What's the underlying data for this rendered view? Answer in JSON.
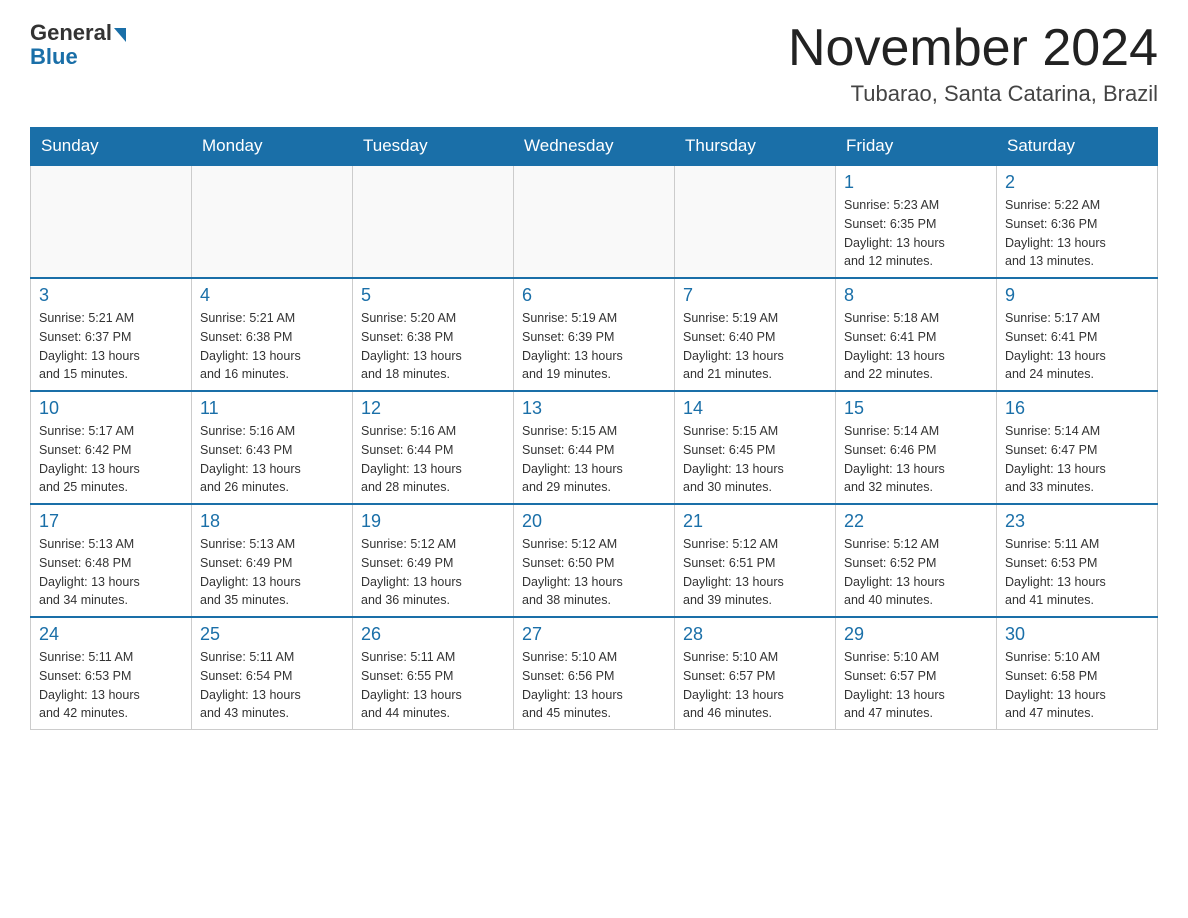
{
  "header": {
    "logo_general": "General",
    "logo_blue": "Blue",
    "month_title": "November 2024",
    "location": "Tubarao, Santa Catarina, Brazil"
  },
  "days_of_week": [
    "Sunday",
    "Monday",
    "Tuesday",
    "Wednesday",
    "Thursday",
    "Friday",
    "Saturday"
  ],
  "weeks": [
    [
      {
        "day": "",
        "info": ""
      },
      {
        "day": "",
        "info": ""
      },
      {
        "day": "",
        "info": ""
      },
      {
        "day": "",
        "info": ""
      },
      {
        "day": "",
        "info": ""
      },
      {
        "day": "1",
        "info": "Sunrise: 5:23 AM\nSunset: 6:35 PM\nDaylight: 13 hours\nand 12 minutes."
      },
      {
        "day": "2",
        "info": "Sunrise: 5:22 AM\nSunset: 6:36 PM\nDaylight: 13 hours\nand 13 minutes."
      }
    ],
    [
      {
        "day": "3",
        "info": "Sunrise: 5:21 AM\nSunset: 6:37 PM\nDaylight: 13 hours\nand 15 minutes."
      },
      {
        "day": "4",
        "info": "Sunrise: 5:21 AM\nSunset: 6:38 PM\nDaylight: 13 hours\nand 16 minutes."
      },
      {
        "day": "5",
        "info": "Sunrise: 5:20 AM\nSunset: 6:38 PM\nDaylight: 13 hours\nand 18 minutes."
      },
      {
        "day": "6",
        "info": "Sunrise: 5:19 AM\nSunset: 6:39 PM\nDaylight: 13 hours\nand 19 minutes."
      },
      {
        "day": "7",
        "info": "Sunrise: 5:19 AM\nSunset: 6:40 PM\nDaylight: 13 hours\nand 21 minutes."
      },
      {
        "day": "8",
        "info": "Sunrise: 5:18 AM\nSunset: 6:41 PM\nDaylight: 13 hours\nand 22 minutes."
      },
      {
        "day": "9",
        "info": "Sunrise: 5:17 AM\nSunset: 6:41 PM\nDaylight: 13 hours\nand 24 minutes."
      }
    ],
    [
      {
        "day": "10",
        "info": "Sunrise: 5:17 AM\nSunset: 6:42 PM\nDaylight: 13 hours\nand 25 minutes."
      },
      {
        "day": "11",
        "info": "Sunrise: 5:16 AM\nSunset: 6:43 PM\nDaylight: 13 hours\nand 26 minutes."
      },
      {
        "day": "12",
        "info": "Sunrise: 5:16 AM\nSunset: 6:44 PM\nDaylight: 13 hours\nand 28 minutes."
      },
      {
        "day": "13",
        "info": "Sunrise: 5:15 AM\nSunset: 6:44 PM\nDaylight: 13 hours\nand 29 minutes."
      },
      {
        "day": "14",
        "info": "Sunrise: 5:15 AM\nSunset: 6:45 PM\nDaylight: 13 hours\nand 30 minutes."
      },
      {
        "day": "15",
        "info": "Sunrise: 5:14 AM\nSunset: 6:46 PM\nDaylight: 13 hours\nand 32 minutes."
      },
      {
        "day": "16",
        "info": "Sunrise: 5:14 AM\nSunset: 6:47 PM\nDaylight: 13 hours\nand 33 minutes."
      }
    ],
    [
      {
        "day": "17",
        "info": "Sunrise: 5:13 AM\nSunset: 6:48 PM\nDaylight: 13 hours\nand 34 minutes."
      },
      {
        "day": "18",
        "info": "Sunrise: 5:13 AM\nSunset: 6:49 PM\nDaylight: 13 hours\nand 35 minutes."
      },
      {
        "day": "19",
        "info": "Sunrise: 5:12 AM\nSunset: 6:49 PM\nDaylight: 13 hours\nand 36 minutes."
      },
      {
        "day": "20",
        "info": "Sunrise: 5:12 AM\nSunset: 6:50 PM\nDaylight: 13 hours\nand 38 minutes."
      },
      {
        "day": "21",
        "info": "Sunrise: 5:12 AM\nSunset: 6:51 PM\nDaylight: 13 hours\nand 39 minutes."
      },
      {
        "day": "22",
        "info": "Sunrise: 5:12 AM\nSunset: 6:52 PM\nDaylight: 13 hours\nand 40 minutes."
      },
      {
        "day": "23",
        "info": "Sunrise: 5:11 AM\nSunset: 6:53 PM\nDaylight: 13 hours\nand 41 minutes."
      }
    ],
    [
      {
        "day": "24",
        "info": "Sunrise: 5:11 AM\nSunset: 6:53 PM\nDaylight: 13 hours\nand 42 minutes."
      },
      {
        "day": "25",
        "info": "Sunrise: 5:11 AM\nSunset: 6:54 PM\nDaylight: 13 hours\nand 43 minutes."
      },
      {
        "day": "26",
        "info": "Sunrise: 5:11 AM\nSunset: 6:55 PM\nDaylight: 13 hours\nand 44 minutes."
      },
      {
        "day": "27",
        "info": "Sunrise: 5:10 AM\nSunset: 6:56 PM\nDaylight: 13 hours\nand 45 minutes."
      },
      {
        "day": "28",
        "info": "Sunrise: 5:10 AM\nSunset: 6:57 PM\nDaylight: 13 hours\nand 46 minutes."
      },
      {
        "day": "29",
        "info": "Sunrise: 5:10 AM\nSunset: 6:57 PM\nDaylight: 13 hours\nand 47 minutes."
      },
      {
        "day": "30",
        "info": "Sunrise: 5:10 AM\nSunset: 6:58 PM\nDaylight: 13 hours\nand 47 minutes."
      }
    ]
  ]
}
